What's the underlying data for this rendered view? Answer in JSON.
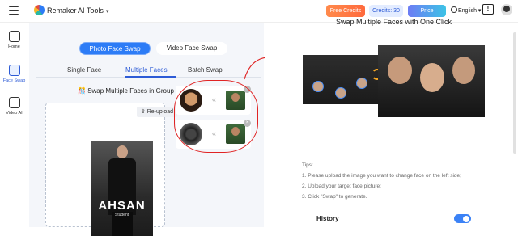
{
  "header": {
    "brand": "Remaker",
    "tools_label": "AI Tools",
    "free_credits_label": "Free Credits",
    "credits_label": "Credits: 30",
    "price_label": "Price",
    "language_label": "English",
    "colors": {
      "free_credits": "#ff7a45",
      "credits_bg": "#e3ecff",
      "price": "#4fa0ec"
    }
  },
  "sidebar": {
    "items": [
      {
        "label": "Home",
        "icon": "home-icon"
      },
      {
        "label": "Face Swap",
        "icon": "face-swap-icon",
        "active": true
      },
      {
        "label": "Video AI",
        "icon": "video-ai-icon"
      }
    ]
  },
  "mode": {
    "photo_label": "Photo Face Swap",
    "video_label": "Video Face Swap"
  },
  "tabs": [
    {
      "label": "Single Face"
    },
    {
      "label": "Multiple Faces",
      "active": true
    },
    {
      "label": "Batch Swap"
    }
  ],
  "subtitle": "Swap Multiple Faces in Group Shots Online",
  "upload": {
    "reupload_label": "Re-upload",
    "poster_title": "AHSAN",
    "poster_subtitle": "Student"
  },
  "right": {
    "title": "Swap Multiple Faces with One Click",
    "tips_heading": "Tips:",
    "tips": [
      "1. Please upload the image you want to change face on the left side;",
      "2. Upload your target face picture;",
      "3. Click \"Swap\" to generate."
    ],
    "history_label": "History",
    "history_enabled": true
  }
}
